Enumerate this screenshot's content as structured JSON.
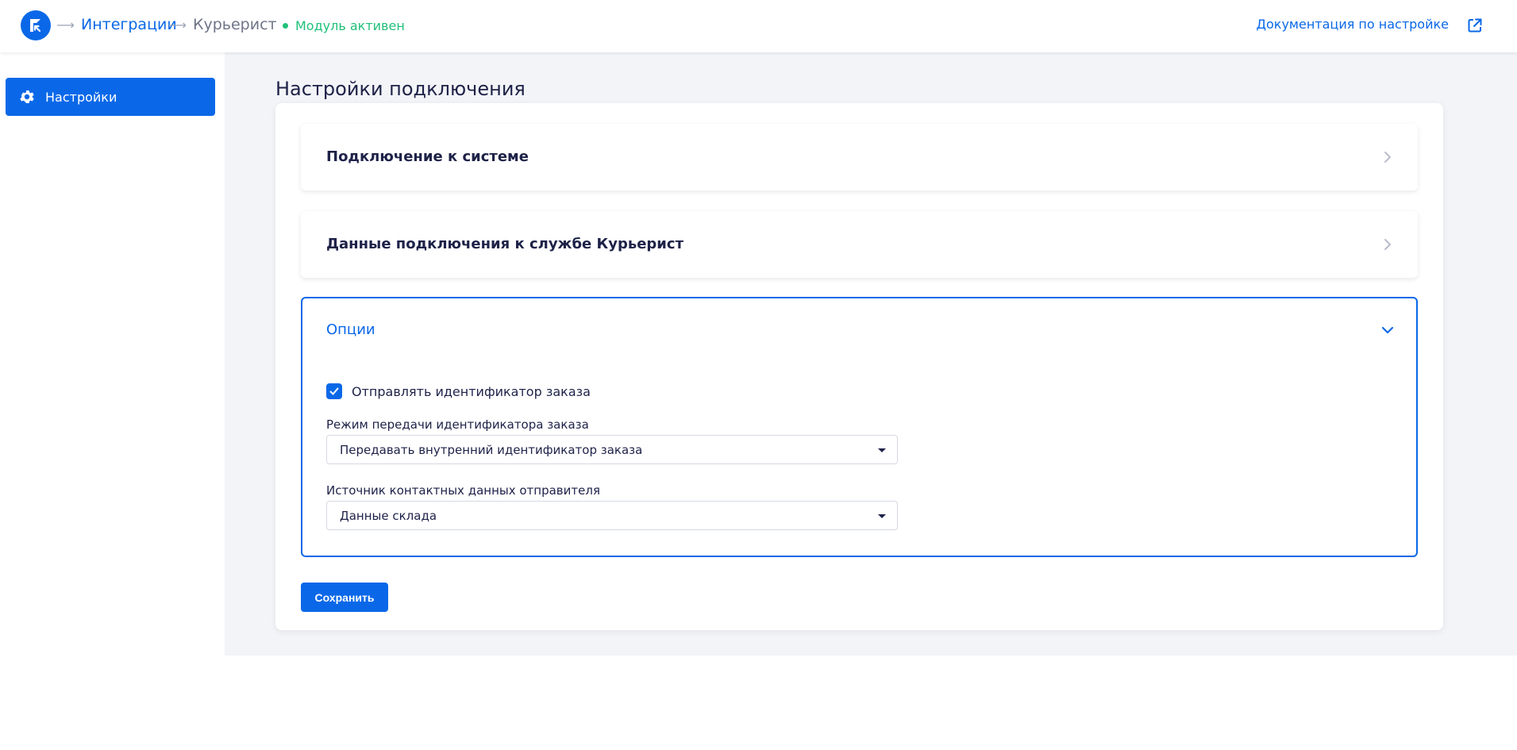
{
  "header": {
    "logo_icon": "retailcrm-logo-icon",
    "breadcrumb": {
      "separator_icon": "arrow-right-icon",
      "integrations_label": "Интеграции",
      "current_label": "Курьерист"
    },
    "status": {
      "text": "Модуль активен",
      "color": "#20c07a"
    },
    "doc_link": {
      "label": "Документация по настройке",
      "icon": "external-link-icon"
    }
  },
  "sidebar": {
    "items": [
      {
        "label": "Настройки",
        "icon": "gear-icon",
        "active": true
      }
    ]
  },
  "main": {
    "title": "Настройки подключения",
    "sections": [
      {
        "title": "Подключение к системе",
        "expanded": false,
        "icon": "chevron-right-icon"
      },
      {
        "title": "Данные подключения к службе Курьерист",
        "expanded": false,
        "icon": "chevron-right-icon"
      },
      {
        "title": "Опции",
        "expanded": true,
        "icon": "chevron-down-icon",
        "checkbox": {
          "label": "Отправлять идентификатор заказа",
          "checked": true
        },
        "fields": [
          {
            "label": "Режим передачи идентификатора заказа",
            "value": "Передавать внутренний идентификатор заказа"
          },
          {
            "label": "Источник контактных данных отправителя",
            "value": "Данные склада"
          }
        ]
      }
    ],
    "save_label": "Сохранить"
  },
  "colors": {
    "accent": "#0a68e8",
    "text": "#1e2248",
    "background": "#f3f4f7",
    "success": "#20c07a"
  }
}
